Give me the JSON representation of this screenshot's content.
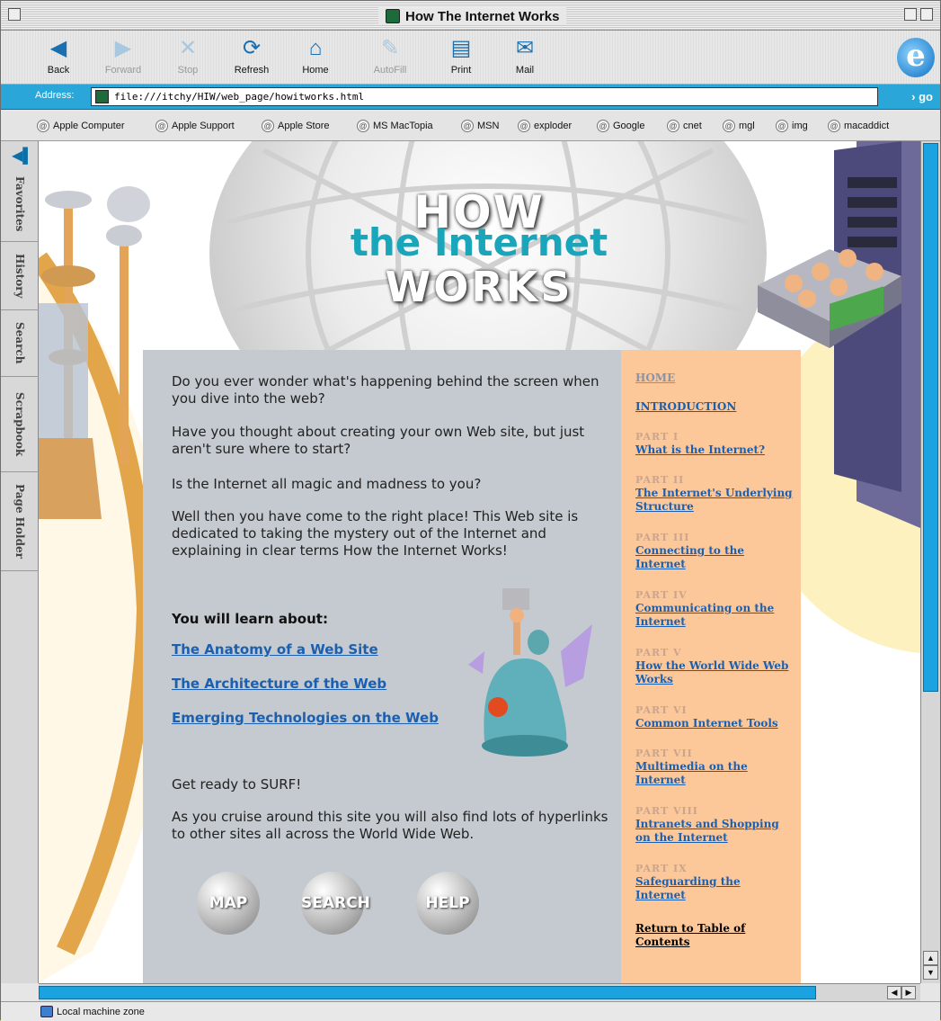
{
  "window": {
    "title": "How The Internet Works"
  },
  "toolbar": {
    "back": "Back",
    "forward": "Forward",
    "stop": "Stop",
    "refresh": "Refresh",
    "home": "Home",
    "autofill": "AutoFill",
    "print": "Print",
    "mail": "Mail"
  },
  "address": {
    "label": "Address:",
    "url": "file:///itchy/HIW/web_page/howitworks.html",
    "go": "go"
  },
  "favorites": [
    "Apple Computer",
    "Apple Support",
    "Apple Store",
    "MS MacTopia",
    "MSN",
    "exploder",
    "Google",
    "cnet",
    "mgl",
    "img",
    "macaddict"
  ],
  "side_tabs": [
    "Favorites",
    "History",
    "Search",
    "Scrapbook",
    "Page Holder"
  ],
  "hero": {
    "line1": "HOW",
    "line2": "the Internet",
    "line3": "WORKS"
  },
  "main": {
    "p1": "Do you ever wonder what's happening behind the screen when you dive into the web?",
    "p2": "Have you thought about creating your own Web site, but just aren't sure where to start?",
    "p3": "Is the Internet all magic and madness to you?",
    "p4": "Well then you have come to the right place! This Web site is dedicated to taking the mystery out of the Internet and explaining in clear terms How the Internet Works!",
    "learn_heading": "You will learn about:",
    "learn_links": [
      "The Anatomy of a Web Site",
      "The Architecture of the Web",
      "Emerging Technologies on the Web"
    ],
    "surf": "Get ready to SURF!",
    "cruise": "As you cruise around this site you will also find lots of hyperlinks to other sites all across the World Wide Web.",
    "buttons": [
      "MAP",
      "SEARCH",
      "HELP"
    ]
  },
  "nav": {
    "home": "HOME",
    "intro": "INTRODUCTION",
    "parts": [
      {
        "label": "PART I",
        "title": "What is the Internet?"
      },
      {
        "label": "PART II",
        "title": "The Internet's Underlying Structure"
      },
      {
        "label": "PART III",
        "title": "Connecting to the Internet"
      },
      {
        "label": "PART IV",
        "title": "Communicating on the Internet"
      },
      {
        "label": "PART V",
        "title": "How the World Wide Web Works"
      },
      {
        "label": "PART VI",
        "title": "Common Internet Tools"
      },
      {
        "label": "PART VII",
        "title": "Multimedia on the Internet"
      },
      {
        "label": "PART VIII",
        "title": "Intranets and Shopping on the Internet"
      },
      {
        "label": "PART IX",
        "title": "Safeguarding the Internet"
      }
    ],
    "return": "Return to Table of Contents"
  },
  "status": {
    "zone": "Local machine zone"
  },
  "colors": {
    "accent": "#2aa7d8",
    "nav_bg": "#fdc899",
    "panel_bg": "#c4cacf",
    "link": "#1c5fae",
    "hero_teal": "#1aa6ba"
  },
  "icons": [
    "back-icon",
    "forward-icon",
    "stop-icon",
    "refresh-icon",
    "home-icon",
    "autofill-icon",
    "print-icon",
    "mail-icon",
    "ie-logo-icon"
  ]
}
